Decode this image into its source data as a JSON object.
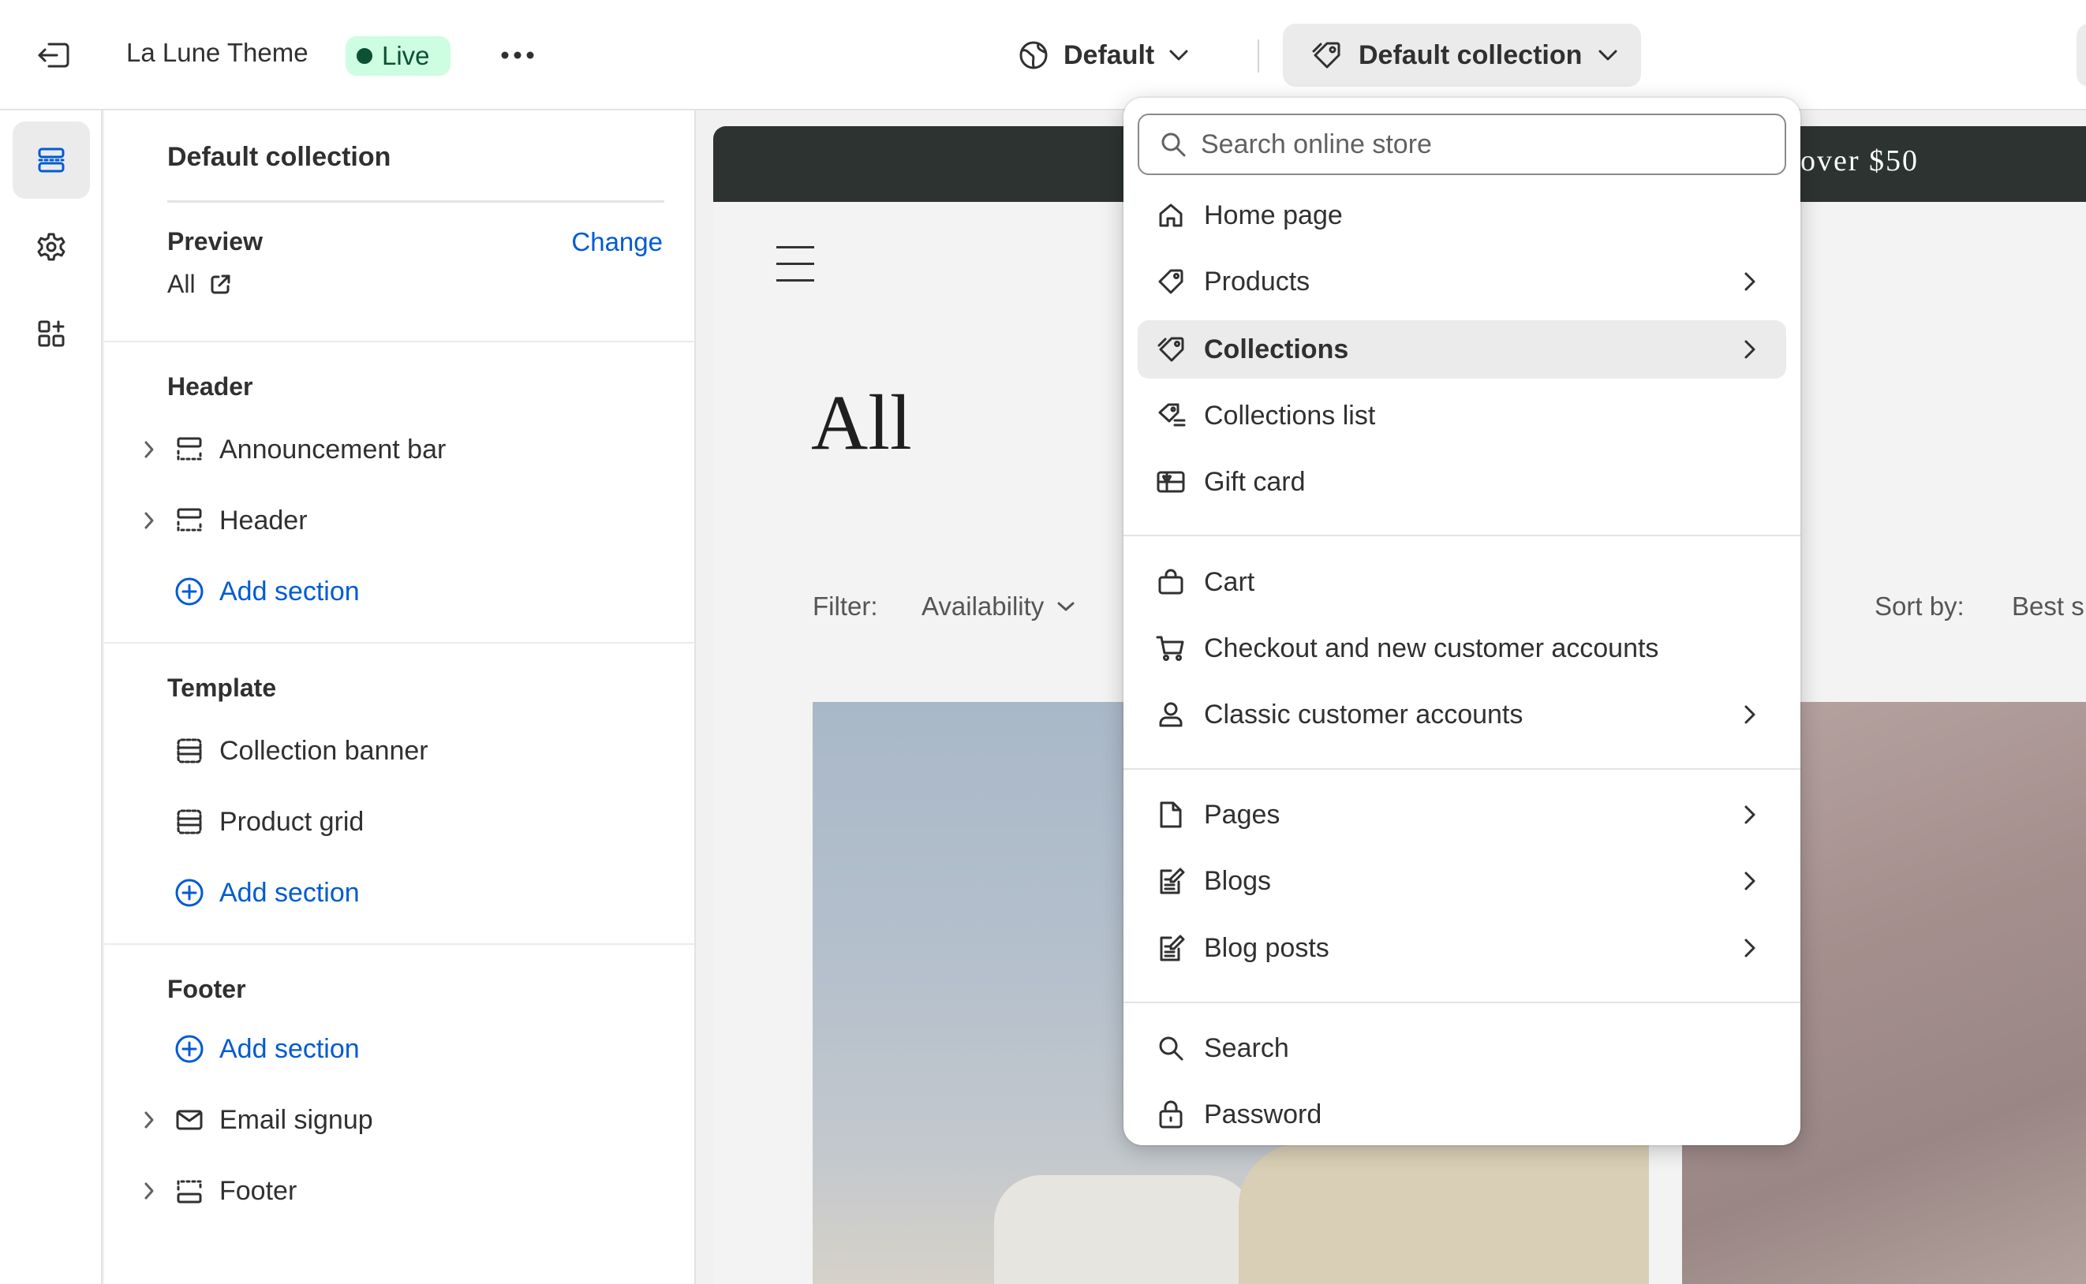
{
  "topbar": {
    "theme_name": "La Lune Theme",
    "live_badge": "Live",
    "market_label": "Default",
    "template_label": "Default collection",
    "icons": [
      "exit-icon",
      "more-icon",
      "globe-icon",
      "tag-icon",
      "chevron-down-icon"
    ]
  },
  "rail": {
    "items": [
      {
        "name": "sections",
        "icon": "sections-icon",
        "active": true
      },
      {
        "name": "theme-settings",
        "icon": "gear-icon",
        "active": false
      },
      {
        "name": "apps",
        "icon": "apps-icon",
        "active": false
      }
    ]
  },
  "sidebar": {
    "title": "Default collection",
    "preview_label": "Preview",
    "change_label": "Change",
    "preview_value": "All",
    "header_group": {
      "title": "Header",
      "items": [
        {
          "label": "Announcement bar",
          "expandable": true
        },
        {
          "label": "Header",
          "expandable": true
        }
      ],
      "add_label": "Add section"
    },
    "template_group": {
      "title": "Template",
      "items": [
        {
          "label": "Collection banner",
          "expandable": false
        },
        {
          "label": "Product grid",
          "expandable": false
        }
      ],
      "add_label": "Add section"
    },
    "footer_group": {
      "title": "Footer",
      "add_label": "Add section",
      "items": [
        {
          "label": "Email signup",
          "expandable": true
        },
        {
          "label": "Footer",
          "expandable": true
        }
      ]
    }
  },
  "preview": {
    "announcement_text": "over $50",
    "collection_title": "All",
    "filter_label": "Filter:",
    "filter_availability": "Availability",
    "sort_label": "Sort by:",
    "sort_value": "Best s"
  },
  "dropdown": {
    "search_placeholder": "Search online store",
    "items": [
      {
        "label": "Home page",
        "icon": "home-icon",
        "submenu": false,
        "selected": false
      },
      {
        "label": "Products",
        "icon": "tag-icon",
        "submenu": true,
        "selected": false
      },
      {
        "label": "Collections",
        "icon": "tags-icon",
        "submenu": true,
        "selected": true
      },
      {
        "label": "Collections list",
        "icon": "tags-list-icon",
        "submenu": false,
        "selected": false
      },
      {
        "label": "Gift card",
        "icon": "gift-card-icon",
        "submenu": false,
        "selected": false
      },
      {
        "label": "Cart",
        "icon": "bag-icon",
        "submenu": false,
        "selected": false
      },
      {
        "label": "Checkout and new customer accounts",
        "icon": "cart-icon",
        "submenu": false,
        "selected": false
      },
      {
        "label": "Classic customer accounts",
        "icon": "person-icon",
        "submenu": true,
        "selected": false
      },
      {
        "label": "Pages",
        "icon": "page-icon",
        "submenu": true,
        "selected": false
      },
      {
        "label": "Blogs",
        "icon": "blog-icon",
        "submenu": true,
        "selected": false
      },
      {
        "label": "Blog posts",
        "icon": "blog-post-icon",
        "submenu": true,
        "selected": false
      },
      {
        "label": "Search",
        "icon": "search-icon",
        "submenu": false,
        "selected": false
      },
      {
        "label": "Password",
        "icon": "lock-icon",
        "submenu": false,
        "selected": false
      }
    ]
  },
  "colors": {
    "accent_link": "#005bd3",
    "live_badge_bg": "#cdfee1",
    "live_badge_text": "#0c5132",
    "announcement_bg": "#2d3330",
    "selected_item_bg": "#ebebeb"
  }
}
